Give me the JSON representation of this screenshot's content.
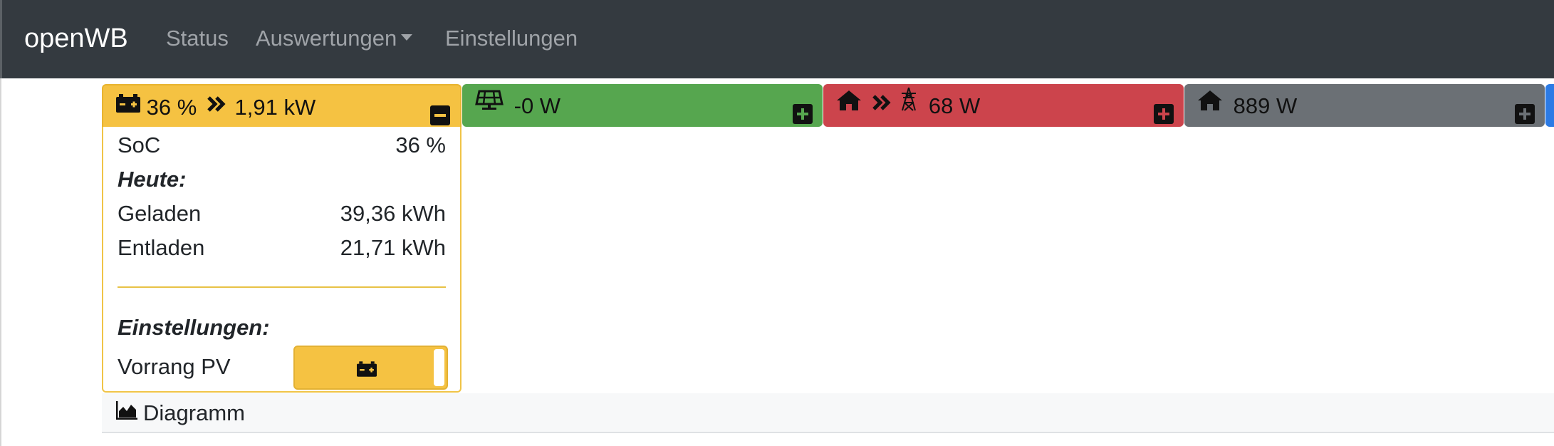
{
  "navbar": {
    "brand": "openWB",
    "items": [
      {
        "label": "Status"
      },
      {
        "label": "Auswertungen",
        "dropdown": true
      },
      {
        "label": "Einstellungen"
      }
    ]
  },
  "tiles": {
    "battery": {
      "soc_header": "36 %",
      "power": "1,91 kW",
      "color": "#f5c242",
      "toggle_icon": "minus-square-icon",
      "details": {
        "soc_label": "SoC",
        "soc_value": "36 %",
        "today_heading": "Heute:",
        "charged_label": "Geladen",
        "charged_value": "39,36 kWh",
        "discharged_label": "Entladen",
        "discharged_value": "21,71 kWh",
        "settings_heading": "Einstellungen:",
        "priority_label": "Vorrang PV",
        "priority_icon": "car-battery-icon"
      }
    },
    "pv": {
      "power": "-0 W",
      "color": "#56a64f",
      "icon": "solar-panel-icon",
      "toggle_icon": "plus-square-icon"
    },
    "grid": {
      "power": "68 W",
      "color": "#cc444c",
      "icon": "home-to-grid-icon",
      "toggle_icon": "plus-square-icon"
    },
    "home": {
      "power": "889 W",
      "color": "#6b7075",
      "icon": "home-icon",
      "toggle_icon": "plus-square-icon"
    }
  },
  "diagram": {
    "label": "Diagramm",
    "icon": "area-chart-icon"
  }
}
